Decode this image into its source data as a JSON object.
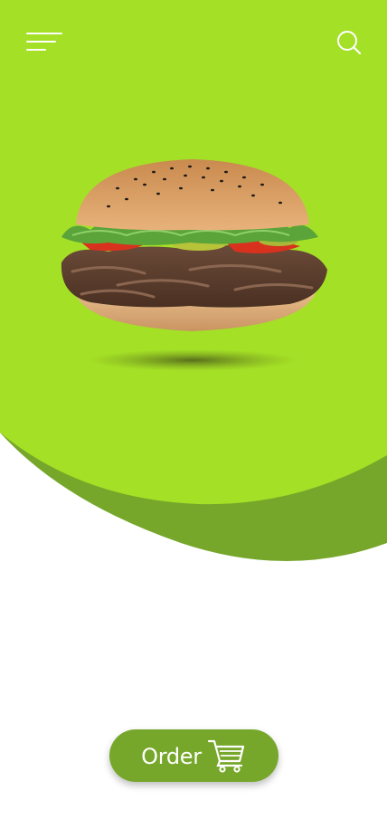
{
  "theme": {
    "accent": "#a4e026",
    "accent_dark": "#76a72a",
    "background": "#ffffff"
  },
  "header": {
    "menu_icon": "hamburger-menu-icon",
    "search_icon": "search-icon"
  },
  "product": {
    "image": "burger-image"
  },
  "order_button": {
    "label": "Order",
    "icon": "shopping-cart-icon"
  }
}
